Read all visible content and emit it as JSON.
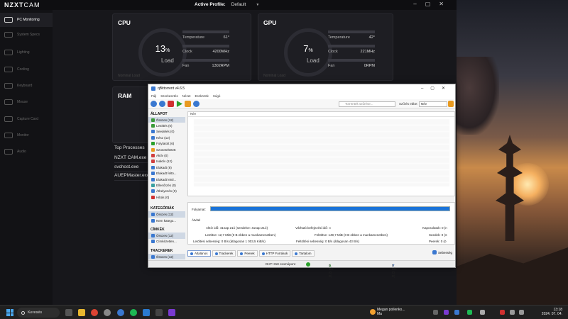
{
  "cam": {
    "logo_bold": "NZXT",
    "logo_thin": "CAM",
    "profile_label": "Active Profile:",
    "profile_value": "Default",
    "nav": [
      {
        "label": "PC Monitoring",
        "icon": "monitor-icon",
        "active": true
      },
      {
        "label": "System Specs",
        "icon": "specs-icon"
      },
      {
        "label": "Lighting",
        "icon": "lighting-icon"
      },
      {
        "label": "Cooling",
        "icon": "cooling-icon"
      },
      {
        "label": "Keyboard",
        "icon": "keyboard-icon"
      },
      {
        "label": "Mouse",
        "icon": "mouse-icon"
      },
      {
        "label": "Capture Card",
        "icon": "capture-card-icon"
      },
      {
        "label": "Monitor",
        "icon": "display-icon"
      },
      {
        "label": "Audio",
        "icon": "audio-icon"
      }
    ],
    "cpu": {
      "title": "CPU",
      "pct": "13",
      "unit": "%",
      "label": "Load",
      "temp_label": "Temperature",
      "temp_value": "61°",
      "clock_label": "Clock",
      "clock_value": "4200MHz",
      "fan_label": "Fan",
      "fan_value": "1302RPM",
      "footer": "Nominal Load"
    },
    "gpu": {
      "title": "GPU",
      "pct": "7",
      "unit": "%",
      "label": "Load",
      "temp_label": "Temperature",
      "temp_value": "42°",
      "clock_label": "Clock",
      "clock_value": "221MHz",
      "fan_label": "Fan",
      "fan_value": "0RPM",
      "footer": "Nominal Load"
    },
    "ram": {
      "title": "RAM"
    },
    "processes": {
      "title": "Top Processes",
      "items": [
        "NZXT CAM.exe",
        "svchost.exe",
        "AUEPMaster.exe"
      ]
    }
  },
  "qb": {
    "title": "qBittorrent v4.6.5",
    "menu": [
      "Fájl",
      "Szerkesztés",
      "Nézet",
      "Eszközök",
      "Súgó"
    ],
    "search_placeholder": "Torrentek szűrése...",
    "filter_label": "Szűrés ebbe:",
    "filter_value": "Név",
    "list_header": "Név",
    "sections": {
      "status": "ÁLLAPOT",
      "categories": "KATEGÓRIÁK",
      "tags": "CÍMKÉK",
      "trackers": "TRACKEREK"
    },
    "status_items": [
      {
        "label": "Összes (12)",
        "color": "#3a9a3a"
      },
      {
        "label": "Letöltés (0)",
        "color": "#3a9a3a"
      },
      {
        "label": "Seedelés (0)",
        "color": "#3a78d0"
      },
      {
        "label": "Kész (12)",
        "color": "#3a78d0"
      },
      {
        "label": "Folytatott (6)",
        "color": "#2aa02a"
      },
      {
        "label": "Szüneteltetett",
        "color": "#e89a20"
      },
      {
        "label": "Aktív (0)",
        "color": "#d04040"
      },
      {
        "label": "Inaktív (12)",
        "color": "#d04040"
      },
      {
        "label": "Elakadt (8)",
        "color": "#3a78d0"
      },
      {
        "label": "Elakadt feltö...",
        "color": "#3a78d0"
      },
      {
        "label": "Elakadt letöl...",
        "color": "#3a78d0"
      },
      {
        "label": "Ellenőrzés (0)",
        "color": "#3aa0a0"
      },
      {
        "label": "Áthelyezés (0)",
        "color": "#3a78d0"
      },
      {
        "label": "Hibás (0)",
        "color": "#d03030"
      }
    ],
    "category_items": [
      "Összes (12)",
      "Nem katego..."
    ],
    "tag_items": [
      "Összes (12)",
      "Címkézetlen..."
    ],
    "tracker_items": [
      "Összes (12)"
    ],
    "progress_label": "Folyamat:",
    "progress_fraction": 1.0,
    "transfer_label": "Átvitel",
    "props": {
      "active_time": "Aktív idő: 41nap 21ó (seedelve: 41nap 21ó)",
      "eta": "Várható befejezési idő: ∞",
      "connections": "Kapcsolatok: 0 (n",
      "downloaded": "Letöltve: 12,7 MiB (0 B ebben a munkamenetben)",
      "uploaded": "Feltöltve: 149,7 MiB (0 B ebben a munkamenetben)",
      "seeds": "Seedek: 0 (ö",
      "dl_speed": "Letöltési sebesség: 0 B/s (átlagosan 1 003,5 KiB/s)",
      "ul_speed": "Feltöltési sebesség: 0 B/s (átlagosan 43 B/s)",
      "peers": "Peerek: 0 (ö"
    },
    "tabs": [
      "Általános",
      "Trackerek",
      "Peerek",
      "HTTP Források",
      "Tartalom"
    ],
    "settings": "Sebesség",
    "status_bar": {
      "dht": "DHT: 318 csomópont",
      "down": "0 B/s (0 B)",
      "up": "0 B/s (0 B)"
    }
  },
  "taskbar": {
    "search": "Keresés",
    "weather_line1": "Megan pollenko...",
    "weather_line2": "Ma",
    "time": "13:18",
    "date": "2024. 07. 04."
  }
}
